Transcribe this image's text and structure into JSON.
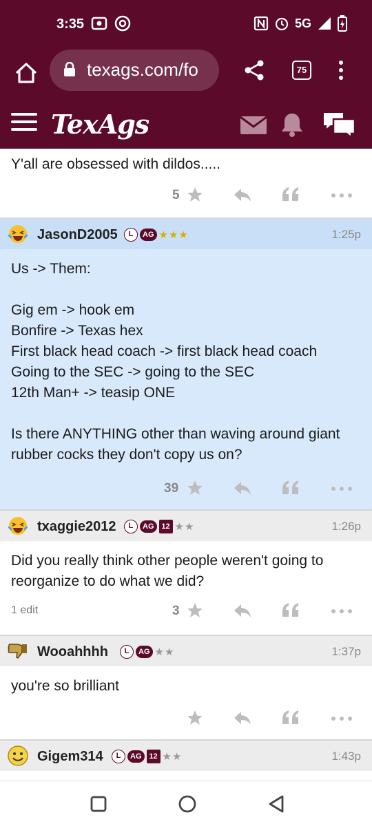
{
  "status": {
    "time": "3:35",
    "network": "5G"
  },
  "browser": {
    "url": "texags.com/fo",
    "tab_count": "75"
  },
  "site": {
    "logo": "TexAgs"
  },
  "partial_post": {
    "body": "Y'all are obsessed with dildos.....",
    "likes": "5"
  },
  "posts": [
    {
      "username": "JasonD2005",
      "badges": [
        "L",
        "AG"
      ],
      "stars": "★★★",
      "time": "1:25p",
      "body": "Us -> Them:\n\nGig em -> hook em\nBonfire -> Texas hex\nFirst black head coach -> first black head coach\nGoing to the SEC -> going to the SEC\n12th Man+ -> teasip ONE\n\nIs there ANYTHING other than waving around giant rubber cocks they don't copy us on?",
      "likes": "39"
    },
    {
      "username": "txaggie2012",
      "badges": [
        "L",
        "AG",
        "12"
      ],
      "stars": "★★",
      "time": "1:26p",
      "body": "Did you really think other people weren't going to reorganize to do what we did?",
      "edit": "1 edit",
      "likes": "3"
    },
    {
      "username": "Wooahhhh",
      "badges": [
        "L",
        "AG"
      ],
      "stars": "★★",
      "time": "1:37p",
      "body": "you're so brilliant",
      "likes": ""
    },
    {
      "username": "Gigem314",
      "badges": [
        "L",
        "AG",
        "12"
      ],
      "stars": "★★",
      "time": "1:43p"
    }
  ],
  "colors": {
    "maroon": "#5c0a2a",
    "highlight": "#d8e9fb",
    "gold_star": "#d4b000",
    "gray_star": "#999999"
  }
}
